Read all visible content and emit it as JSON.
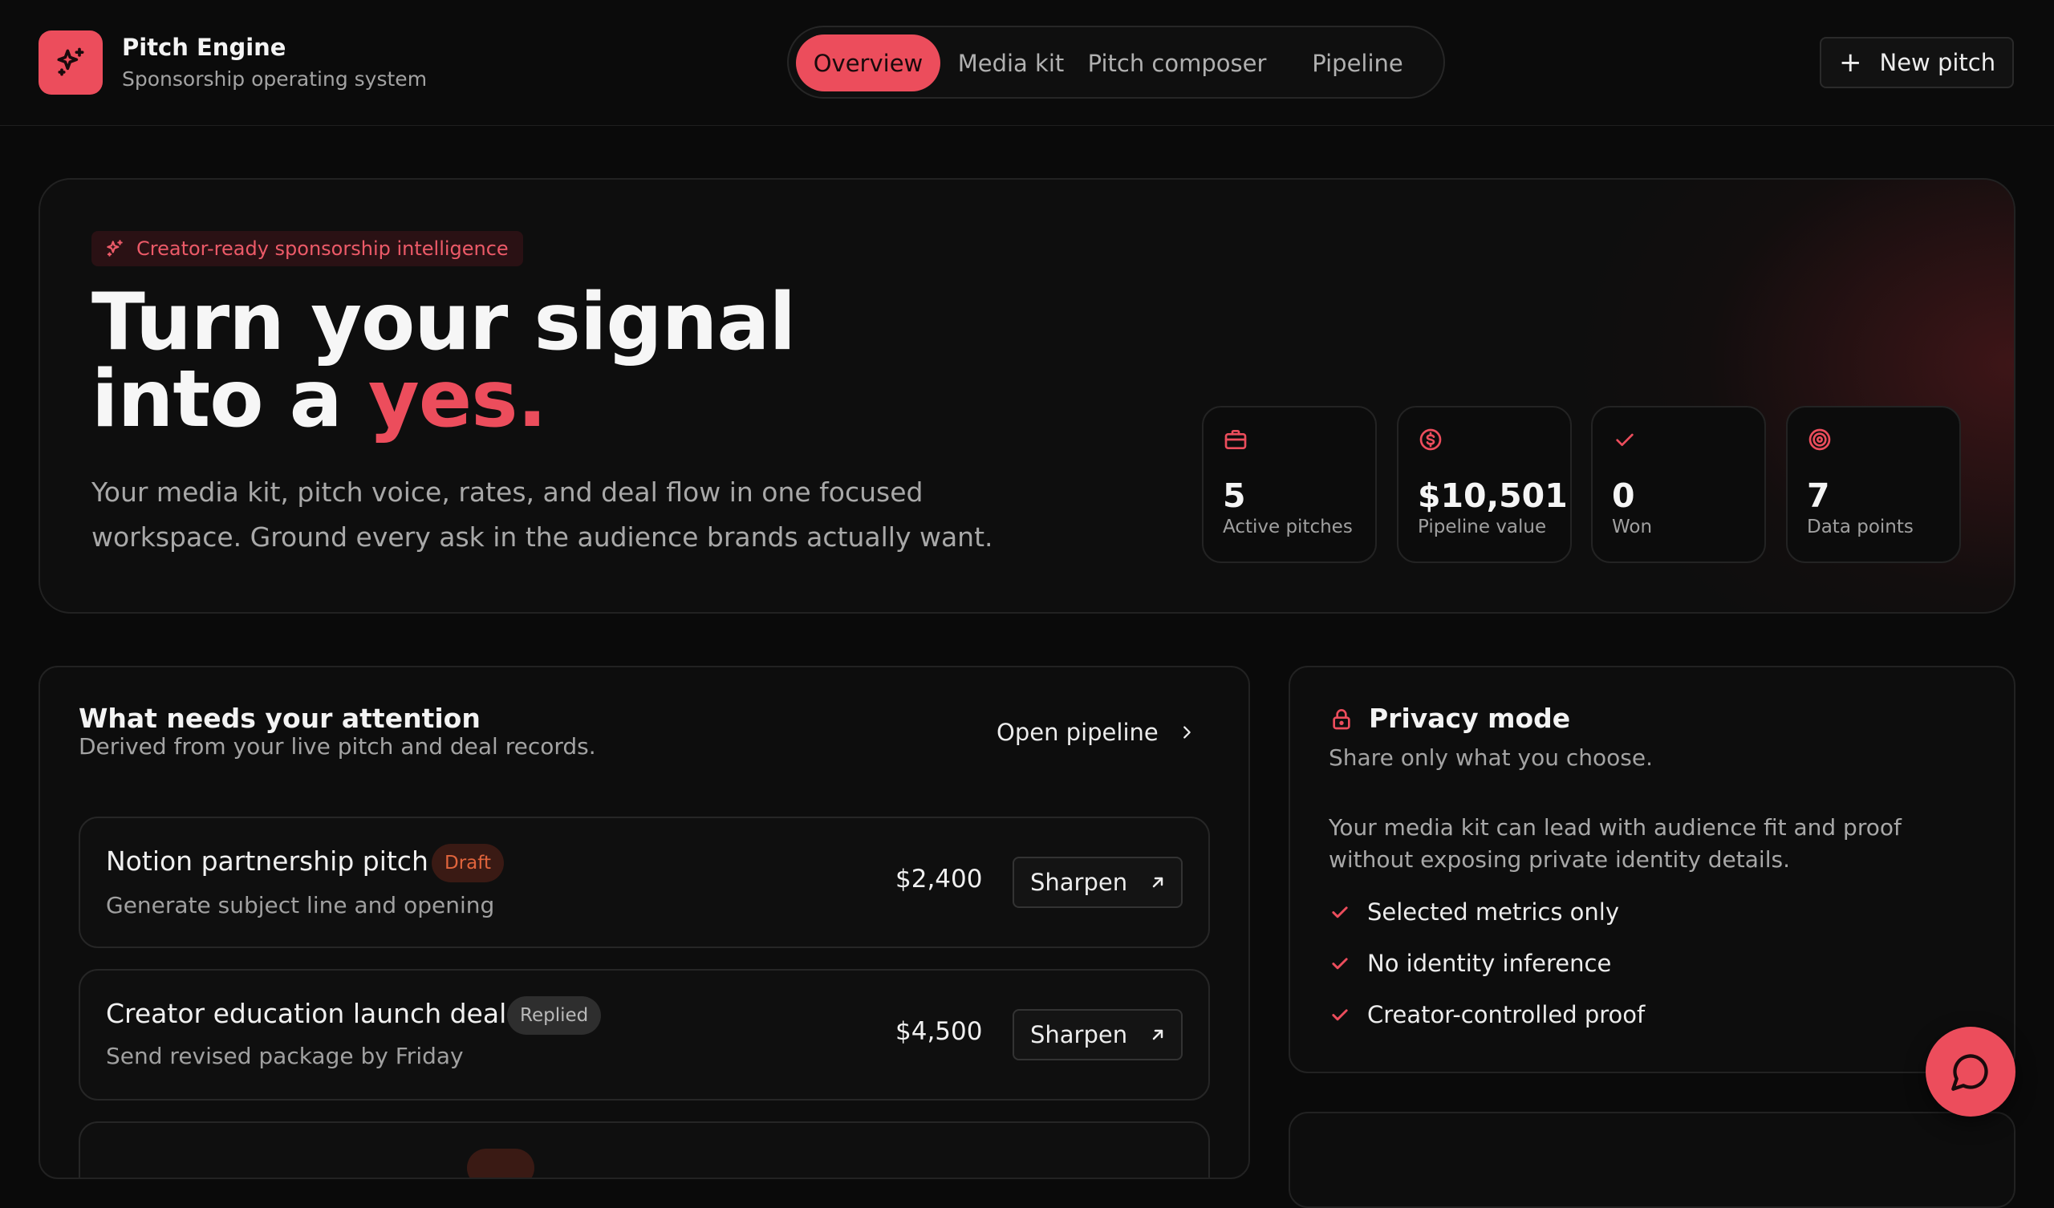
{
  "brand": {
    "title": "Pitch Engine",
    "subtitle": "Sponsorship operating system",
    "logo_icon": "sparkles-icon"
  },
  "nav": {
    "tabs": [
      {
        "label": "Overview",
        "active": true
      },
      {
        "label": "Media kit",
        "active": false
      },
      {
        "label": "Pitch composer",
        "active": false
      },
      {
        "label": "Pipeline",
        "active": false
      }
    ]
  },
  "header": {
    "new_pitch_label": "New pitch"
  },
  "hero": {
    "pill_label": "Creator-ready sponsorship intelligence",
    "headline_line1": "Turn your signal",
    "headline_line2_prefix": "into a ",
    "headline_accent": "yes.",
    "description": "Your media kit, pitch voice, rates, and deal flow in one focused workspace. Ground every ask in the audience brands actually want.",
    "stats": [
      {
        "icon": "briefcase-icon",
        "value": "5",
        "label": "Active pitches"
      },
      {
        "icon": "dollar-circle-icon",
        "value": "$10,501",
        "label": "Pipeline value"
      },
      {
        "icon": "check-icon",
        "value": "0",
        "label": "Won"
      },
      {
        "icon": "target-icon",
        "value": "7",
        "label": "Data points"
      }
    ]
  },
  "attention": {
    "title": "What needs your attention",
    "subtitle": "Derived from your live pitch and deal records.",
    "open_pipeline_label": "Open pipeline",
    "rows": [
      {
        "title": "Notion partnership pitch",
        "badge": "Draft",
        "subtitle": "Generate subject line and opening",
        "amount": "$2,400",
        "action": "Sharpen"
      },
      {
        "title": "Creator education launch deal",
        "badge": "Replied",
        "subtitle": "Send revised package by Friday",
        "amount": "$4,500",
        "action": "Sharpen"
      }
    ]
  },
  "privacy": {
    "title": "Privacy mode",
    "subtitle": "Share only what you choose.",
    "body": "Your media kit can lead with audience fit and proof without exposing private identity details.",
    "checks": [
      "Selected metrics only",
      "No identity inference",
      "Creator-controlled proof"
    ]
  },
  "colors": {
    "accent": "#ec4d5c",
    "background": "#0a0a0a",
    "draft_badge": "#e0643c"
  }
}
